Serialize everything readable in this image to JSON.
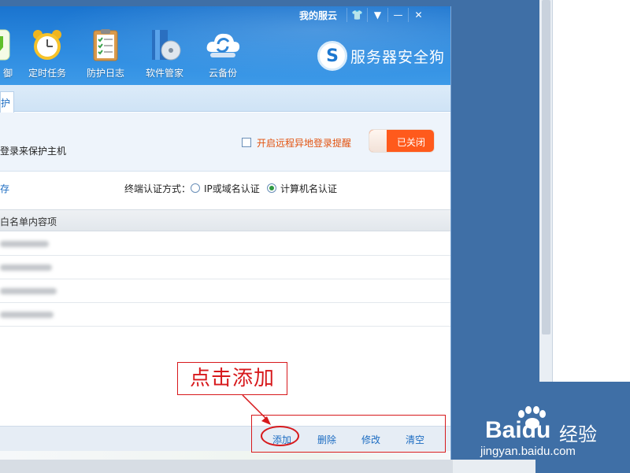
{
  "window": {
    "cloud_link": "我的服云",
    "controls": [
      "👕",
      "▼",
      "—",
      "✕"
    ]
  },
  "nav": {
    "items": [
      {
        "label": "御",
        "icon": "shield-icon"
      },
      {
        "label": "定时任务",
        "icon": "alarm-clock-icon"
      },
      {
        "label": "防护日志",
        "icon": "clipboard-icon"
      },
      {
        "label": "软件管家",
        "icon": "software-box-icon"
      },
      {
        "label": "云备份",
        "icon": "cloud-sync-icon"
      }
    ]
  },
  "brand": {
    "logo_letter": "S",
    "name": "服务器安全狗"
  },
  "tabs": {
    "active_label": "护"
  },
  "remote_login": {
    "description": "登录来保护主机",
    "alert_label": "开启远程异地登录提醒",
    "alert_checked": false,
    "toggle_label": "已关闭"
  },
  "auth": {
    "left_link": "存",
    "label": "终端认证方式：",
    "options": [
      {
        "label": "IP或域名认证",
        "selected": false
      },
      {
        "label": "计算机名认证",
        "selected": true
      }
    ]
  },
  "whitelist": {
    "header": "白名单内容项",
    "rows_count_blurred": 4
  },
  "actions": {
    "add": "添加",
    "delete": "删除",
    "edit": "修改",
    "clear": "清空"
  },
  "annotation": {
    "callout": "点击添加",
    "color": "#d7191c"
  },
  "watermark": {
    "logo": "Baidu",
    "text": "经验",
    "url": "jingyan.baidu.com"
  }
}
